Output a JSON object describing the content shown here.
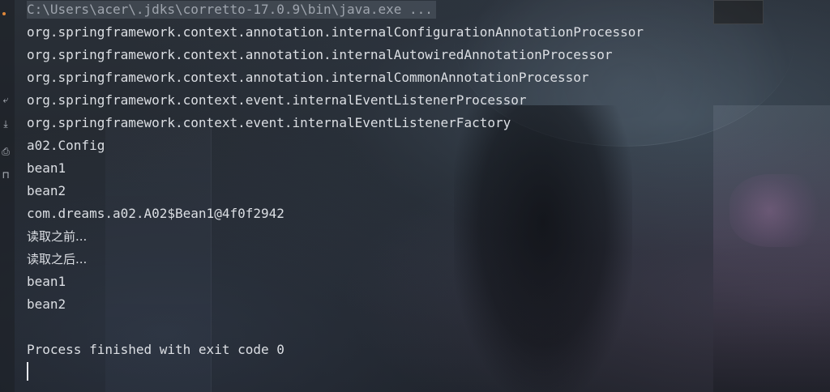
{
  "console": {
    "command": "C:\\Users\\acer\\.jdks\\corretto-17.0.9\\bin\\java.exe ...",
    "lines": [
      "org.springframework.context.annotation.internalConfigurationAnnotationProcessor",
      "org.springframework.context.annotation.internalAutowiredAnnotationProcessor",
      "org.springframework.context.annotation.internalCommonAnnotationProcessor",
      "org.springframework.context.event.internalEventListenerProcessor",
      "org.springframework.context.event.internalEventListenerFactory",
      "a02.Config",
      "bean1",
      "bean2",
      "com.dreams.a02.A02$Bean1@4f0f2942",
      "读取之前...",
      "读取之后...",
      "bean1",
      "bean2",
      "",
      "Process finished with exit code 0"
    ]
  },
  "gutter": {
    "icons": [
      {
        "name": "wrap-lines-icon",
        "glyph": "⤶"
      },
      {
        "name": "scroll-to-end-icon",
        "glyph": "⤓"
      },
      {
        "name": "print-icon",
        "glyph": "⎙"
      },
      {
        "name": "pin-icon",
        "glyph": "⊓"
      }
    ]
  },
  "colors": {
    "text": "#dcdfe4",
    "command_text": "#9ea4ad",
    "run_indicator": "#e0883a"
  }
}
